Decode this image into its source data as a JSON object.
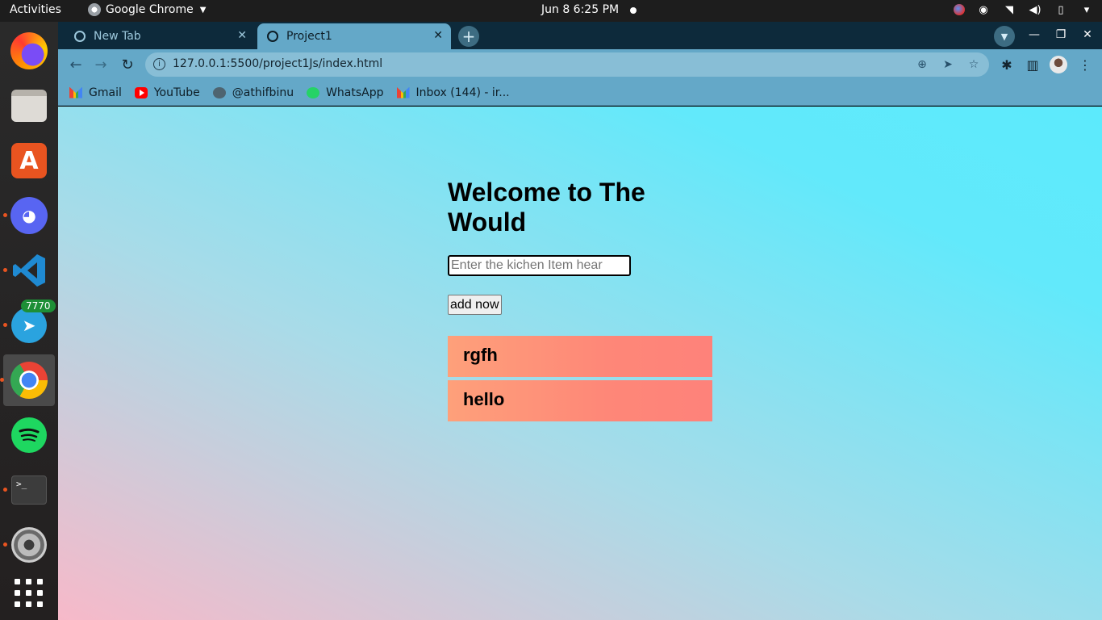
{
  "system": {
    "activities": "Activities",
    "app_name": "Google Chrome",
    "clock": "Jun 8   6:25 PM"
  },
  "dock": {
    "telegram_badge": "7770",
    "items": [
      "firefox-icon",
      "files-icon",
      "app-store-icon",
      "discord-icon",
      "vscode-icon",
      "telegram-icon",
      "chrome-icon",
      "spotify-icon",
      "terminal-icon",
      "settings-icon",
      "app-grid-icon"
    ]
  },
  "browser": {
    "tabs": [
      {
        "title": "New Tab",
        "active": false
      },
      {
        "title": "Project1",
        "active": true
      }
    ],
    "url": "127.0.0.1:5500/project1Js/index.html",
    "bookmarks": [
      "Gmail",
      "YouTube",
      "@athifbinu",
      "WhatsApp",
      "Inbox (144) - ir..."
    ]
  },
  "page": {
    "heading": "Welcome to The Would",
    "input_placeholder": "Enter the kichen Item hear",
    "input_value": "",
    "add_button": "add now",
    "items": [
      "rgfh",
      "hello"
    ]
  },
  "colors": {
    "tab_active": "#64a8c8",
    "tabstrip": "#0d2a3b",
    "item_gradient_start": "#fea07a",
    "item_gradient_end": "#fe827a",
    "page_gradient_pink": "#f7b9c9",
    "page_gradient_cyan": "#5ceafc"
  }
}
